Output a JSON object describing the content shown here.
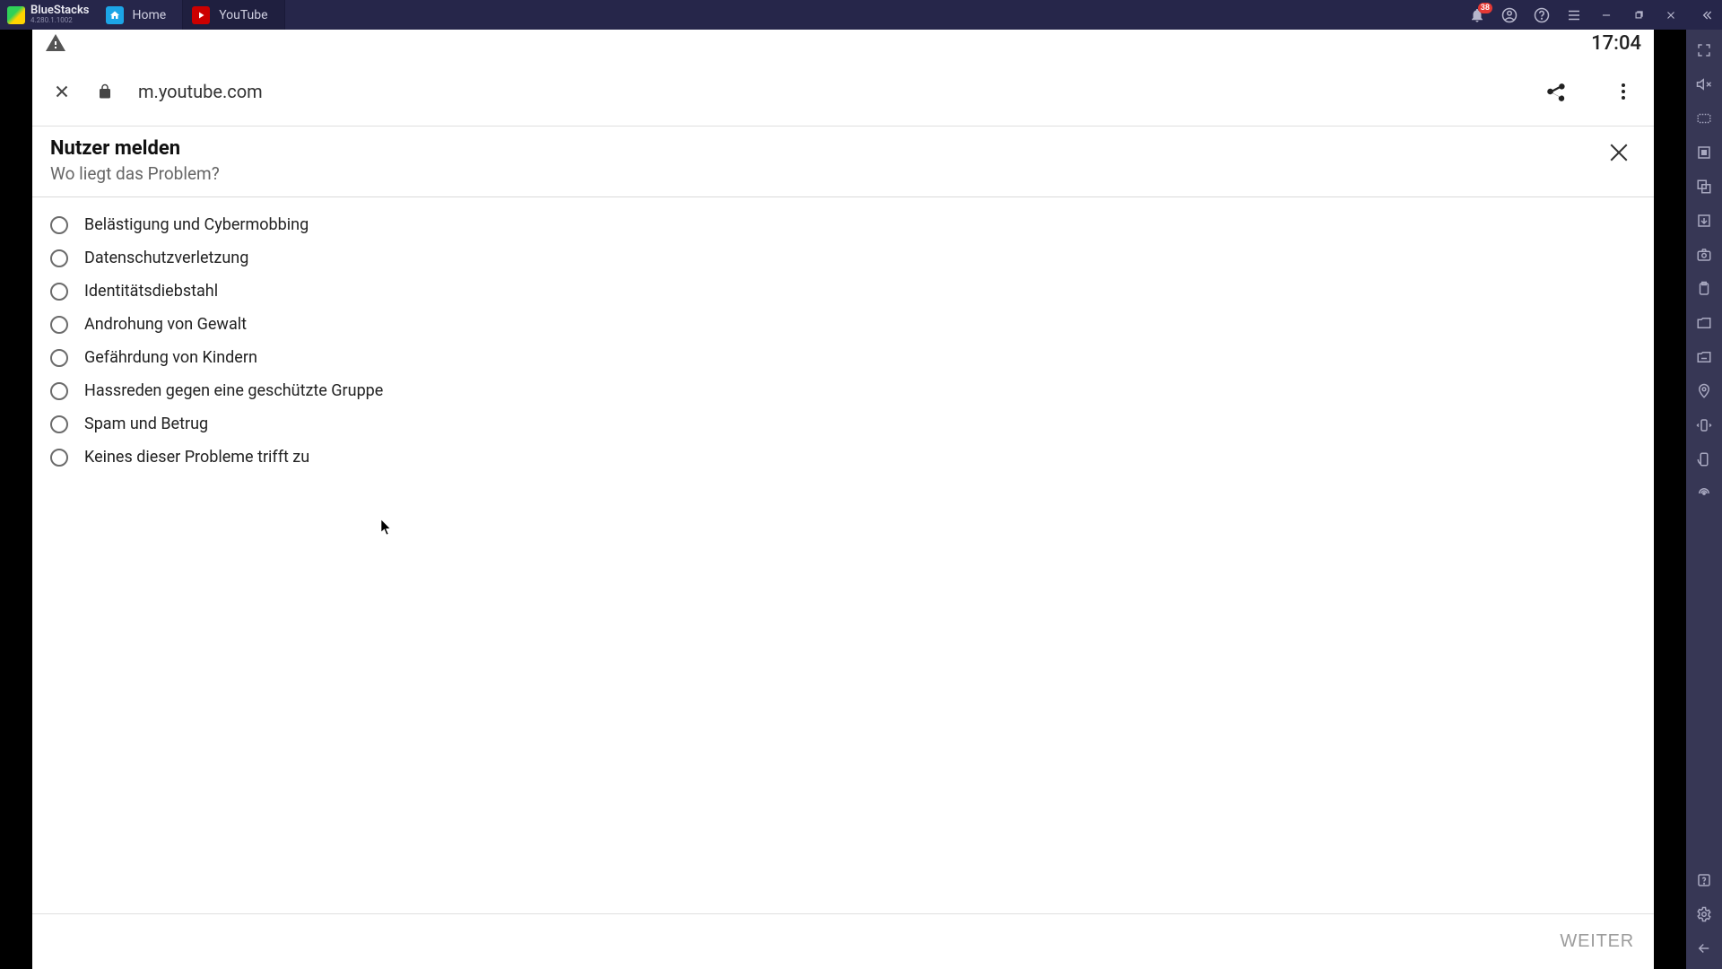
{
  "bluestacks": {
    "brand": "BlueStacks",
    "version": "4.280.1.1002",
    "notifications_badge": "38"
  },
  "tabs": [
    {
      "label": "Home",
      "icon": "home"
    },
    {
      "label": "YouTube",
      "icon": "youtube"
    }
  ],
  "status_bar": {
    "time": "17:04"
  },
  "browser_bar": {
    "url": "m.youtube.com"
  },
  "dialog": {
    "title": "Nutzer melden",
    "subtitle": "Wo liegt das Problem?",
    "options": [
      "Belästigung und Cybermobbing",
      "Datenschutzverletzung",
      "Identitätsdiebstahl",
      "Androhung von Gewalt",
      "Gefährdung von Kindern",
      "Hassreden gegen eine geschützte Gruppe",
      "Spam und Betrug",
      "Keines dieser Probleme trifft zu"
    ],
    "next_button": "WEITER"
  }
}
